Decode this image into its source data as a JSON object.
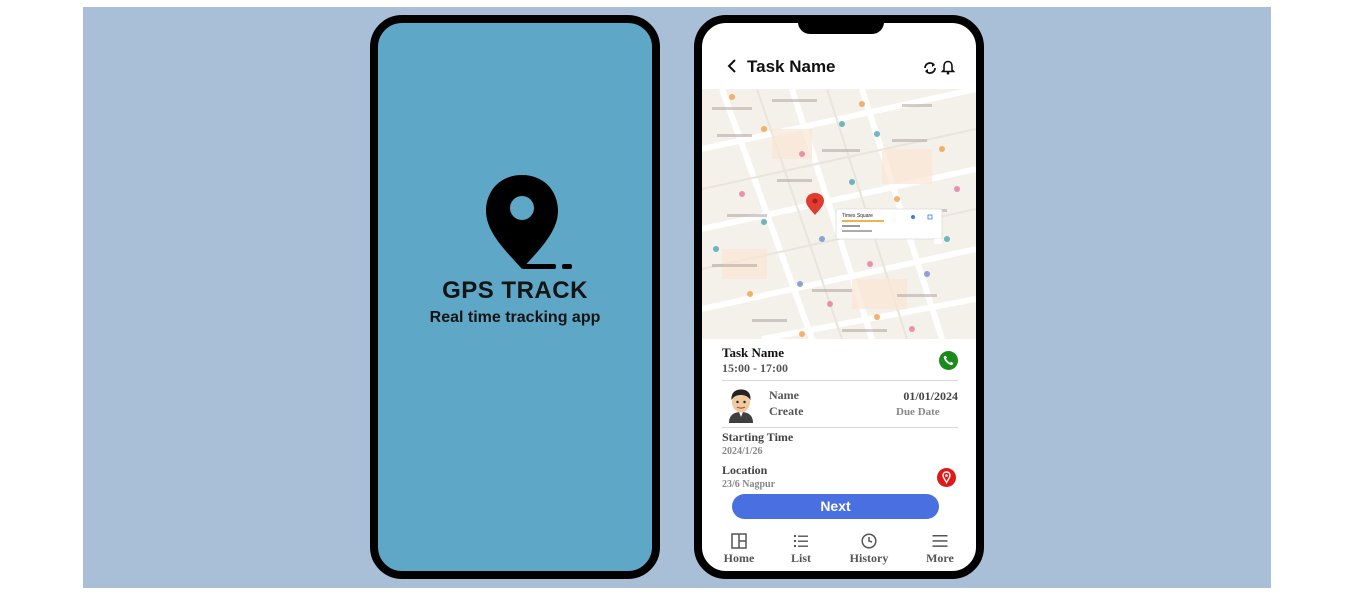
{
  "splash": {
    "title": "GPS TRACK",
    "subtitle": "Real time tracking app",
    "background": "#5fa7c7"
  },
  "header": {
    "title": "Task Name",
    "icons": [
      "back-icon",
      "refresh-icon",
      "bell-icon"
    ]
  },
  "task": {
    "name": "Task Name",
    "time": "15:00 - 17:00",
    "call_icon": "phone-icon"
  },
  "creator": {
    "name": "Name",
    "role": "Create",
    "date": "01/01/2024",
    "date_label": "Due Date"
  },
  "starting": {
    "label": "Starting Time",
    "value": "2024/1/26"
  },
  "location": {
    "label": "Location",
    "value": "23/6 Nagpur",
    "icon": "map-pin-icon"
  },
  "map": {
    "place_card_title": "Times Square"
  },
  "actions": {
    "next_label": "Next"
  },
  "nav": {
    "items": [
      {
        "label": "Home",
        "icon": "home-icon"
      },
      {
        "label": "List",
        "icon": "list-icon"
      },
      {
        "label": "History",
        "icon": "clock-icon"
      },
      {
        "label": "More",
        "icon": "menu-icon"
      }
    ]
  },
  "colors": {
    "stage": "#a9bfd8",
    "accent": "#4a6fe0",
    "call": "#1a8a1a",
    "pin": "#e01818"
  }
}
